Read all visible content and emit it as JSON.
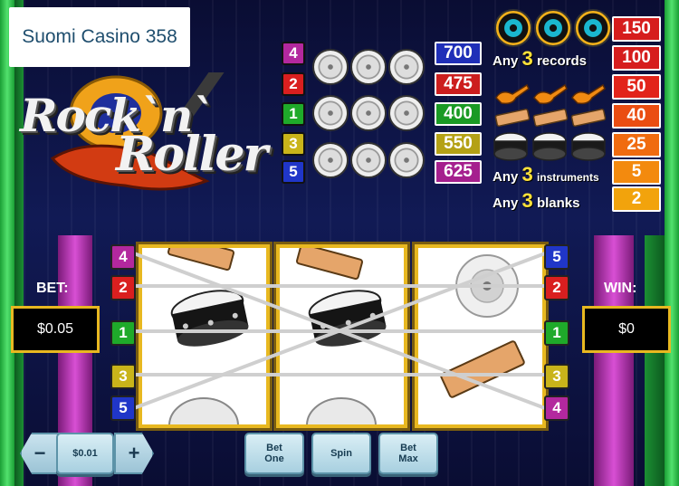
{
  "site_label": "Suomi Casino 358",
  "logo": {
    "line1": "Rock`n`",
    "line2": "Roller"
  },
  "paylines": [
    {
      "line": "4",
      "color": "#b3289e",
      "payout": "700",
      "payout_color": "#1f2fb8"
    },
    {
      "line": "2",
      "color": "#d91f1f",
      "payout": "475",
      "payout_color": "#cc1e1e"
    },
    {
      "line": "1",
      "color": "#1faa2a",
      "payout": "400",
      "payout_color": "#1a9a24"
    },
    {
      "line": "3",
      "color": "#c9b41a",
      "payout": "550",
      "payout_color": "#b4a116"
    },
    {
      "line": "5",
      "color": "#2036c8",
      "payout": "625",
      "payout_color": "#a51f8e"
    }
  ],
  "paytable": {
    "records_label_pre": "Any",
    "records_label_num": "3",
    "records_label_post": "records",
    "instruments_label_pre": "Any",
    "instruments_label_num": "3",
    "instruments_label_post": "instruments",
    "blanks_label_pre": "Any",
    "blanks_label_num": "3",
    "blanks_label_post": "blanks",
    "values": [
      "150",
      "100",
      "50",
      "40",
      "25",
      "5",
      "2"
    ],
    "value_colors": [
      "#d61d1d",
      "#d61d1d",
      "#e2241a",
      "#ea4d12",
      "#f06b10",
      "#f38a0e",
      "#f2a30c"
    ]
  },
  "reels": {
    "left_badges": [
      "4",
      "2",
      "1",
      "3",
      "5"
    ],
    "right_badges": [
      "5",
      "2",
      "1",
      "3",
      "4"
    ],
    "left_badge_colors": [
      "#b3289e",
      "#d91f1f",
      "#1faa2a",
      "#c9b41a",
      "#2036c8"
    ],
    "right_badge_colors": [
      "#2036c8",
      "#d91f1f",
      "#1faa2a",
      "#c9b41a",
      "#b3289e"
    ]
  },
  "bet_panel": {
    "label": "BET:",
    "value": "$0.05"
  },
  "win_panel": {
    "label": "WIN:",
    "value": "$0"
  },
  "controls": {
    "minus": "−",
    "coin_value": "$0.01",
    "plus": "+",
    "bet_one": "Bet One",
    "spin": "Spin",
    "bet_max": "Bet Max"
  }
}
